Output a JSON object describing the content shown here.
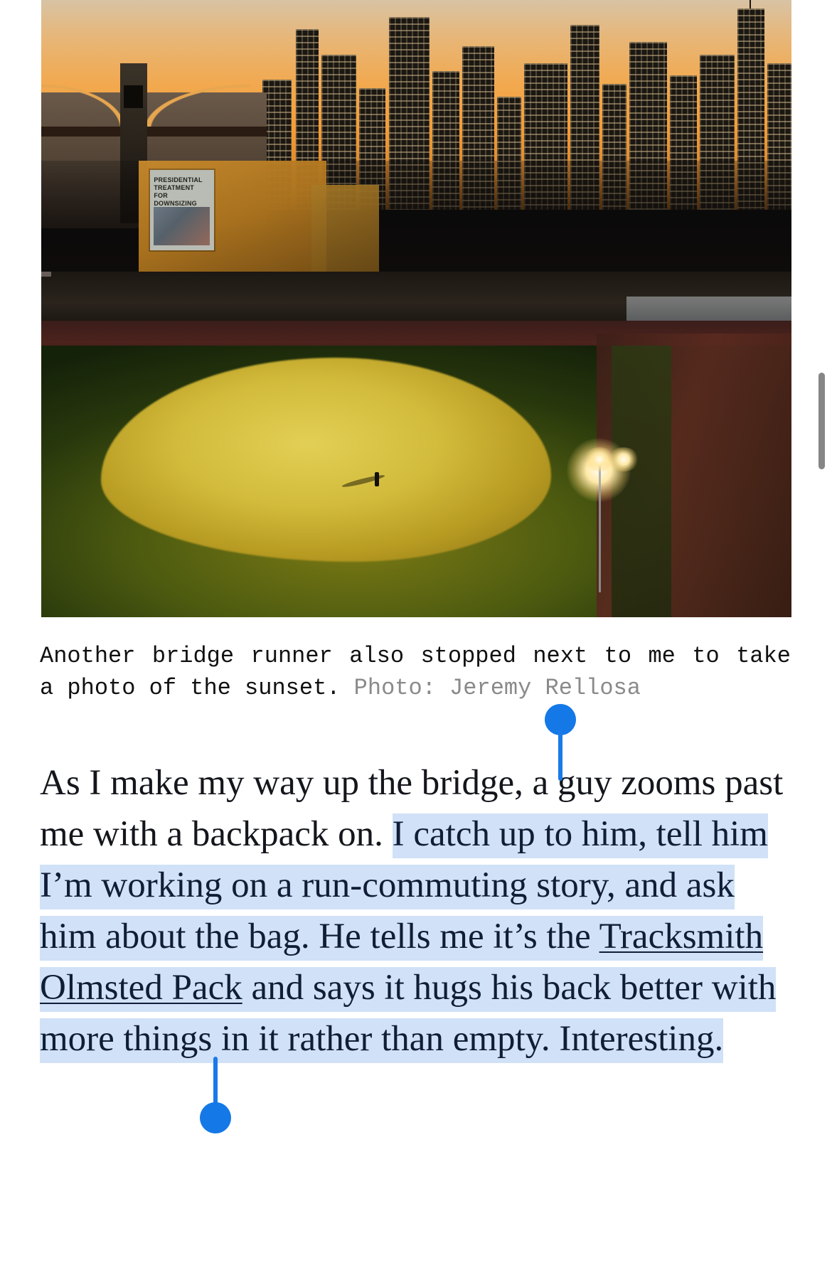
{
  "article": {
    "figure": {
      "alt": "Sunset view of the Brooklyn Bridge and lower Manhattan skyline above a floodlit baseball field",
      "caption_text": "Another bridge runner also stopped next to me to take a photo of the sunset.",
      "credit_text": "Photo: Jeremy Rellosa",
      "billboard_line1": "PRESIDENTIAL",
      "billboard_line2": "TREATMENT",
      "billboard_line3": "FOR DOWNSIZING"
    },
    "body": {
      "paragraph_before_selection": "As I make my way up the bridge, a guy zooms past me with a backpack on. ",
      "selected_part_1": "I catch up to him, tell him I’m working on a run-commuting story, and ask him about the bag. He tells me it’s the ",
      "selected_link": "Tracksmith Olmsted Pack",
      "selected_part_2": " and says it hugs his back better with more things in it rather than empty. Interesting.",
      "link_label": "Tracksmith Olmsted Pack"
    }
  },
  "selection": {
    "highlight_color": "#d0e1f8",
    "handle_color": "#1478e6",
    "selected_text_color": "#111d36",
    "start_handle_name": "selection start handle",
    "end_handle_name": "selection end handle"
  },
  "scrollbar": {
    "color": "#7c7c7c",
    "position": "right"
  },
  "theme": {
    "background": "#ffffff",
    "body_text_color": "#14161c",
    "caption_text_color": "#111111",
    "credit_text_color": "#8a8a8a"
  }
}
